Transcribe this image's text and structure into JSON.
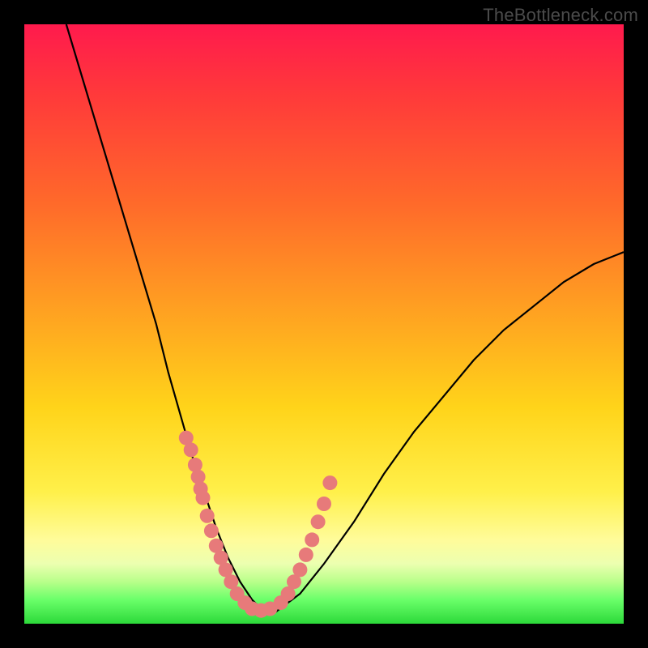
{
  "watermark": "TheBottleneck.com",
  "chart_data": {
    "type": "line",
    "title": "",
    "xlabel": "",
    "ylabel": "",
    "xlim": [
      0,
      100
    ],
    "ylim": [
      0,
      100
    ],
    "series": [
      {
        "name": "bottleneck-curve",
        "x": [
          7,
          10,
          13,
          16,
          19,
          22,
          24,
          26,
          28,
          30,
          32,
          34,
          36,
          38,
          40,
          42,
          46,
          50,
          55,
          60,
          65,
          70,
          75,
          80,
          85,
          90,
          95,
          100
        ],
        "y": [
          100,
          90,
          80,
          70,
          60,
          50,
          42,
          35,
          28,
          22,
          16,
          11,
          7,
          4,
          2,
          2,
          5,
          10,
          17,
          25,
          32,
          38,
          44,
          49,
          53,
          57,
          60,
          62
        ]
      }
    ],
    "markers": {
      "name": "data-points",
      "x": [
        27.0,
        27.8,
        28.5,
        29.0,
        29.4,
        29.8,
        30.5,
        31.2,
        32.0,
        32.8,
        33.6,
        34.5,
        35.5,
        36.8,
        38.0,
        39.5,
        41.0,
        42.8,
        44.0,
        45.0,
        46.0,
        47.0,
        48.0,
        49.0,
        50.0,
        51.0
      ],
      "y": [
        31.0,
        29.0,
        26.5,
        24.5,
        22.5,
        21.0,
        18.0,
        15.5,
        13.0,
        11.0,
        9.0,
        7.0,
        5.0,
        3.5,
        2.5,
        2.2,
        2.5,
        3.5,
        5.0,
        7.0,
        9.0,
        11.5,
        14.0,
        17.0,
        20.0,
        23.5
      ]
    },
    "gradient_stops": [
      {
        "pos": 0,
        "color": "#ff1a4d"
      },
      {
        "pos": 12,
        "color": "#ff3a3a"
      },
      {
        "pos": 30,
        "color": "#ff6a2a"
      },
      {
        "pos": 50,
        "color": "#ffa820"
      },
      {
        "pos": 64,
        "color": "#ffd41a"
      },
      {
        "pos": 78,
        "color": "#fff04a"
      },
      {
        "pos": 86,
        "color": "#fffc9a"
      },
      {
        "pos": 90,
        "color": "#ecffb0"
      },
      {
        "pos": 93,
        "color": "#b8ff8a"
      },
      {
        "pos": 96,
        "color": "#6aff6a"
      },
      {
        "pos": 100,
        "color": "#2dd93a"
      }
    ],
    "curve_color": "#000000",
    "marker_color": "#e77a7a",
    "marker_radius": 9
  }
}
